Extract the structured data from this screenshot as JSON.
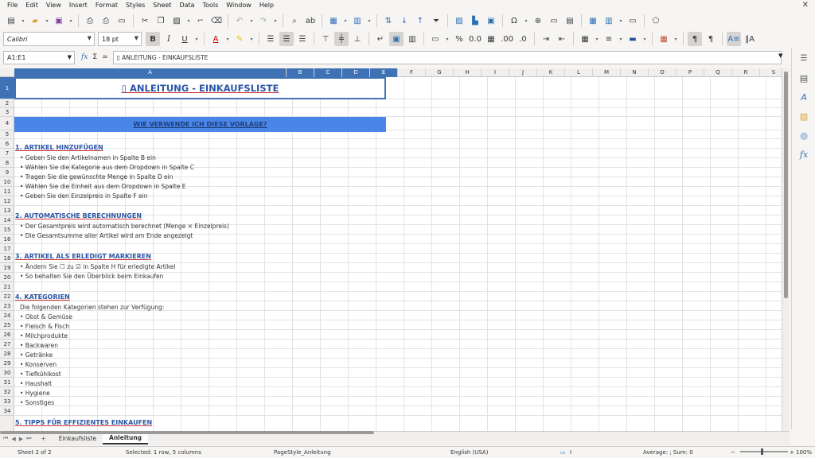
{
  "menu": [
    "File",
    "Edit",
    "View",
    "Insert",
    "Format",
    "Styles",
    "Sheet",
    "Data",
    "Tools",
    "Window",
    "Help"
  ],
  "window_close": "✕",
  "font": {
    "name": "Calibri",
    "size": "18 pt"
  },
  "namebox": "A1:E1",
  "formula_symbols": {
    "fx": "fx",
    "sum": "Σ",
    "equals": "="
  },
  "formula_value": "▯ ANLEITUNG - EINKAUFSLISTE",
  "columns": [
    "A",
    "B",
    "C",
    "D",
    "E",
    "F",
    "G",
    "H",
    "I",
    "J",
    "K",
    "L",
    "M",
    "N",
    "O",
    "P",
    "Q",
    "R",
    "S"
  ],
  "rows": [
    "1",
    "2",
    "3",
    "4",
    "5",
    "6",
    "7",
    "8",
    "9",
    "10",
    "11",
    "12",
    "13",
    "14",
    "15",
    "16",
    "17",
    "18",
    "19",
    "20",
    "21",
    "22",
    "23",
    "24",
    "25",
    "26",
    "27",
    "28",
    "29",
    "30",
    "31",
    "32",
    "33",
    "34"
  ],
  "sheet": {
    "title": "▯ ANLEITUNG - EINKAUFSLISTE",
    "banner": "WIE VERWENDE ICH DIESE VORLAGE?",
    "s1_heading": "1. ARTIKEL HINZUFÜGEN",
    "s1": [
      "• Geben Sie den Artikelnamen in Spalte B ein",
      "• Wählen Sie die Kategorie aus dem Dropdown in Spalte C",
      "• Tragen Sie die gewünschte Menge in Spalte D ein",
      "• Wählen Sie die Einheit aus dem Dropdown in Spalte E",
      "• Geben Sie den Einzelpreis in Spalte F ein"
    ],
    "s2_heading": "2. AUTOMATISCHE BERECHNUNGEN",
    "s2": [
      "• Der Gesamtpreis wird automatisch berechnet (Menge × Einzelpreis)",
      "• Die Gesamtsumme aller Artikel wird am Ende angezeigt"
    ],
    "s3_heading": "3. ARTIKEL ALS ERLEDIGT MARKIEREN",
    "s3": [
      "• Ändern Sie ☐ zu ☑ in Spalte H für erledigte Artikel",
      "• So behalten Sie den Überblick beim Einkaufen"
    ],
    "s4_heading": "4. KATEGORIEN",
    "s4_intro": "Die folgenden Kategorien stehen zur Verfügung:",
    "s4": [
      "• Obst & Gemüse",
      "• Fleisch & Fisch",
      "• Milchprodukte",
      "• Backwaren",
      "• Getränke",
      "• Konserven",
      "• Tiefkühlkost",
      "• Haushalt",
      "• Hygiene",
      "• Sonstiges"
    ],
    "s5_heading": "5. TIPPS FÜR EFFIZIENTES EINKAUFEN"
  },
  "tabs": {
    "add": "+",
    "items": [
      "Einkaufsliste",
      "Anleitung"
    ],
    "active": "Anleitung"
  },
  "status": {
    "sheet": "Sheet 2 of 2",
    "selection": "Selected: 1 row, 5 columns",
    "pagestyle": "PageStyle_Anleitung",
    "language": "English (USA)",
    "summary": "Average: ; Sum: 0",
    "zoom": "100%"
  },
  "colors": {
    "accent": "#3f72b5",
    "banner": "#4a86e8",
    "heading": "#2a56a8"
  }
}
